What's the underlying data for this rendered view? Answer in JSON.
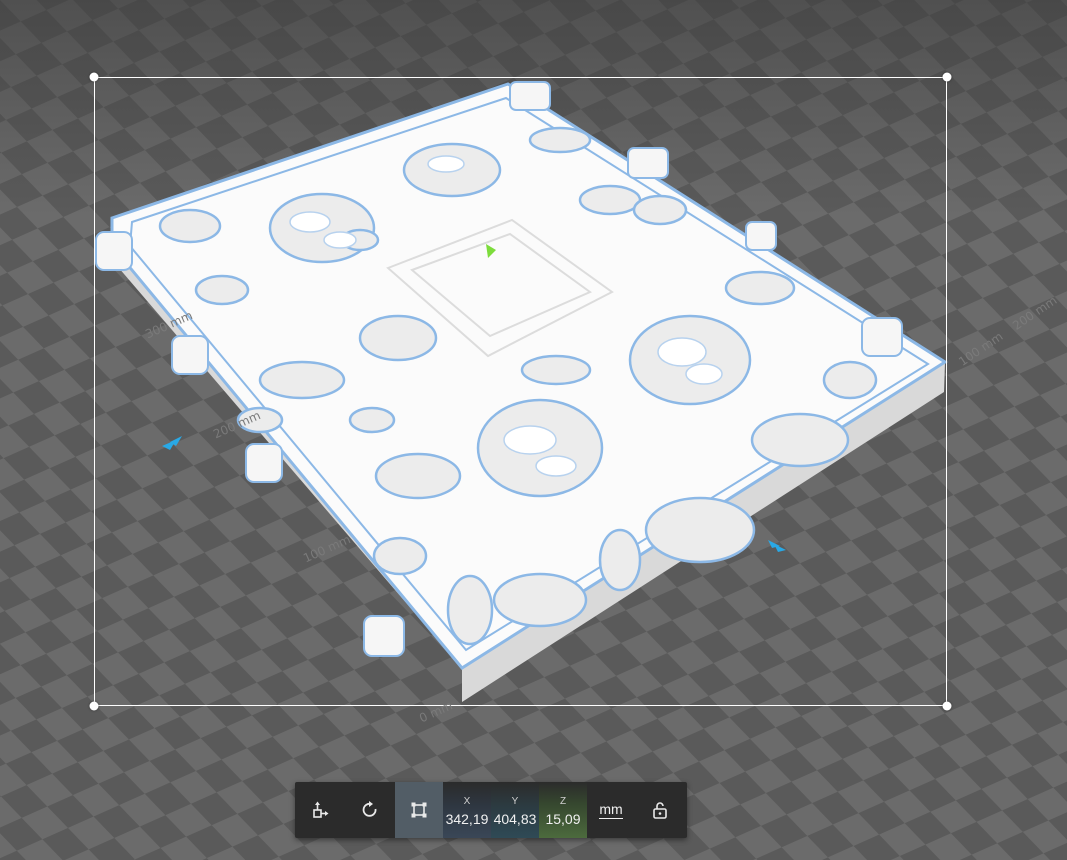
{
  "viewport": {
    "bed_labels": [
      "0 mm",
      "100 mm",
      "200 mm",
      "300 mm",
      "100 mm",
      "200 mm"
    ],
    "colors": {
      "checker_dark": "#545454",
      "checker_light": "#6a6a6a",
      "model": "#ffffff",
      "outline": "#8cb8e6",
      "arrow": "#29a9e6",
      "gizmo": "#7ddc3c"
    }
  },
  "toolbar": {
    "tools": [
      {
        "name": "move-tool",
        "icon": "move-icon"
      },
      {
        "name": "rotate-tool",
        "icon": "rotate-icon"
      },
      {
        "name": "scale-tool",
        "icon": "scale-icon",
        "active": true
      }
    ],
    "dimensions": {
      "x": {
        "label": "X",
        "value": "342,19"
      },
      "y": {
        "label": "Y",
        "value": "404,83"
      },
      "z": {
        "label": "Z",
        "value": "15,09"
      }
    },
    "unit": "mm",
    "lock_icon": "unlock-icon"
  }
}
